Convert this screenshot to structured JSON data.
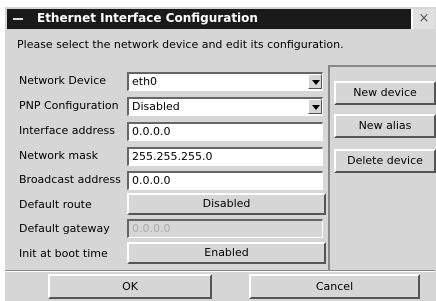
{
  "window": {
    "title": "Ethernet Interface Configuration",
    "close_glyph": "×"
  },
  "prompt": "Please select the network device and edit its configuration.",
  "form": {
    "network_device": {
      "label": "Network Device",
      "value": "eth0"
    },
    "pnp_configuration": {
      "label": "PNP Configuration",
      "value": "Disabled"
    },
    "interface_address": {
      "label": "Interface address",
      "value": "0.0.0.0"
    },
    "network_mask": {
      "label": "Network mask",
      "value": "255.255.255.0"
    },
    "broadcast_address": {
      "label": "Broadcast address",
      "value": "0.0.0.0"
    },
    "default_route": {
      "label": "Default route",
      "value": "Disabled"
    },
    "default_gateway": {
      "label": "Default gateway",
      "value": "0.0.0.0",
      "disabled": true
    },
    "init_at_boot": {
      "label": "Init at boot time",
      "value": "Enabled"
    }
  },
  "side_buttons": {
    "new_device": "New device",
    "new_alias": "New alias",
    "delete_device": "Delete device"
  },
  "footer": {
    "ok": "OK",
    "cancel": "Cancel"
  }
}
